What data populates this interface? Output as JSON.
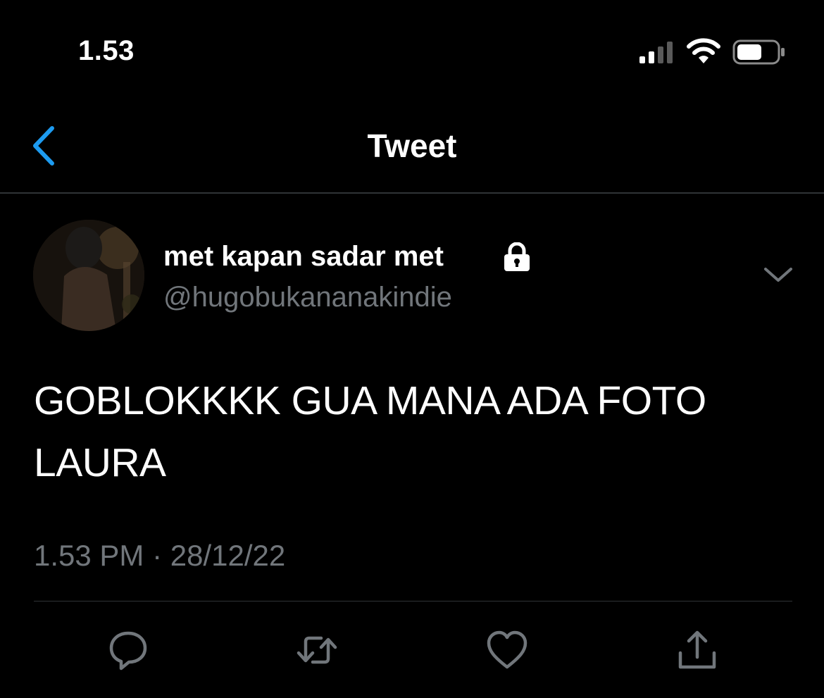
{
  "status_bar": {
    "time": "1.53",
    "icons": [
      "cellular-signal-icon",
      "wifi-icon",
      "battery-icon"
    ]
  },
  "nav": {
    "title": "Tweet",
    "back_icon": "chevron-left-icon"
  },
  "tweet": {
    "author": {
      "display_name": "met kapan sadar met",
      "handle": "@hugobukananakindie",
      "protected": true
    },
    "text": "GOBLOKKKK GUA MANA ADA FOTO LAURA",
    "time": "1.53 PM",
    "separator": "·",
    "date": "28/12/22"
  },
  "actions": [
    "reply-icon",
    "retweet-icon",
    "like-icon",
    "share-icon"
  ],
  "colors": {
    "background": "#000000",
    "text": "#ffffff",
    "secondary_text": "#71767b",
    "accent": "#1d9bf0",
    "divider": "#2f3336"
  }
}
